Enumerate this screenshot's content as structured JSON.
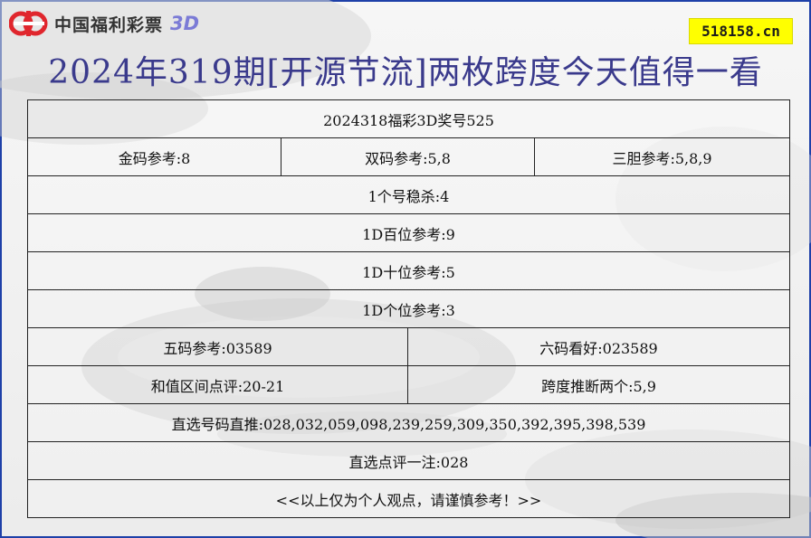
{
  "logo": {
    "icon": "lottery-logo-icon",
    "text": "中国福利彩票",
    "suffix": "3D",
    "colors": {
      "mark": "#e0262d",
      "text": "#333333",
      "suffix": "#7b7bd6"
    }
  },
  "site_badge": "518158.cn",
  "title": "2024年319期[开源节流]两枚跨度今天值得一看",
  "rows": [
    {
      "cells": [
        "2024318福彩3D奖号525"
      ]
    },
    {
      "cells": [
        "金码参考:8",
        "双码参考:5,8",
        "三胆参考:5,8,9"
      ]
    },
    {
      "cells": [
        "1个号稳杀:4"
      ]
    },
    {
      "cells": [
        "1D百位参考:9"
      ]
    },
    {
      "cells": [
        "1D十位参考:5"
      ]
    },
    {
      "cells": [
        "1D个位参考:3"
      ]
    },
    {
      "cells": [
        "五码参考:03589",
        "六码看好:023589"
      ]
    },
    {
      "cells": [
        "和值区间点评:20-21",
        "跨度推断两个:5,9"
      ]
    },
    {
      "cells": [
        "直选号码直推:028,032,059,098,239,259,309,350,392,395,398,539"
      ]
    },
    {
      "cells": [
        "直选点评一注:028"
      ]
    },
    {
      "cells": [
        "<<以上仅为个人观点，请谨慎参考！>>"
      ]
    }
  ],
  "colors": {
    "border": "#1e40a8",
    "title": "#3a3a8c",
    "badge_bg": "#ffff00"
  }
}
